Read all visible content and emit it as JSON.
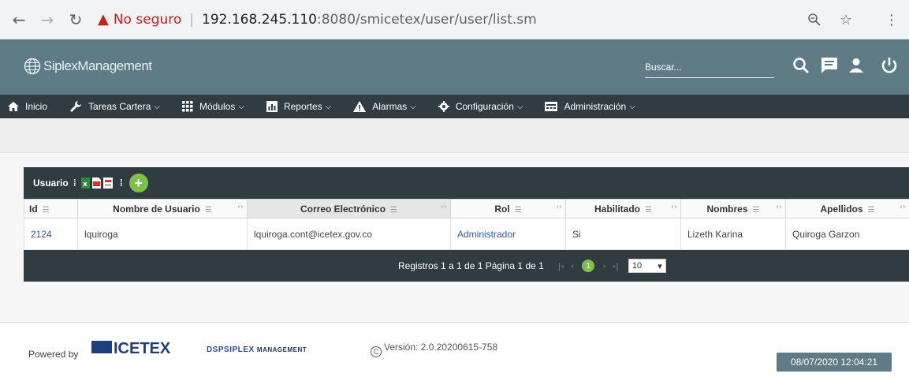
{
  "browser": {
    "warning_text": "No seguro",
    "url_host": "192.168.245.110",
    "url_path": ":8080/smicetex/user/user/list.sm",
    "icons": [
      "back-icon",
      "forward-icon",
      "reload-icon",
      "warning-icon",
      "zoom-icon",
      "star-icon",
      "menu-icon"
    ]
  },
  "header": {
    "logo_text": "SiplexManagement",
    "search_placeholder": "Buscar...",
    "icons": [
      "search-icon",
      "chat-icon",
      "user-icon",
      "power-icon"
    ]
  },
  "nav": {
    "items": [
      {
        "label": "Inicio",
        "icon": "home-icon",
        "has_caret": false
      },
      {
        "label": "Tareas Cartera",
        "icon": "wrench-icon",
        "has_caret": true
      },
      {
        "label": "Módulos",
        "icon": "grid-icon",
        "has_caret": true
      },
      {
        "label": "Reportes",
        "icon": "report-icon",
        "has_caret": true
      },
      {
        "label": "Alarmas",
        "icon": "alarm-icon",
        "has_caret": true
      },
      {
        "label": "Configuración",
        "icon": "gear-icon",
        "has_caret": true
      },
      {
        "label": "Administración",
        "icon": "admin-icon",
        "has_caret": true
      }
    ]
  },
  "panel": {
    "title": "Usuario",
    "add_label": "+",
    "columns": [
      "Id",
      "Nombre de Usuario",
      "Correo Electrónico",
      "Rol",
      "Habilitado",
      "Nombres",
      "Apellidos"
    ],
    "rows": [
      [
        "2124",
        "lquiroga",
        "lquiroga.cont@icetex.gov.co",
        "Administrador",
        "Si",
        "Lizeth Karina",
        "Quiroga Garzon"
      ]
    ],
    "pager_text": "Registros 1 a 1 de 1  Página 1 de 1",
    "current_page": "1",
    "page_size": "10"
  },
  "footer": {
    "powered_by": "Powered by",
    "icetex_text": "ICETEX",
    "siplex_text": "DSPSIPLEX",
    "siplex_sub": "MANAGEMENT",
    "version": "Versión: 2.0.20200615-758",
    "datetime": "08/07/2020 12:04:21"
  },
  "colors": {
    "header": "#5e7b86",
    "navbar": "#303c41",
    "accent_green": "#7cc24a",
    "link": "#2f5da8",
    "warning": "#c5221f"
  }
}
